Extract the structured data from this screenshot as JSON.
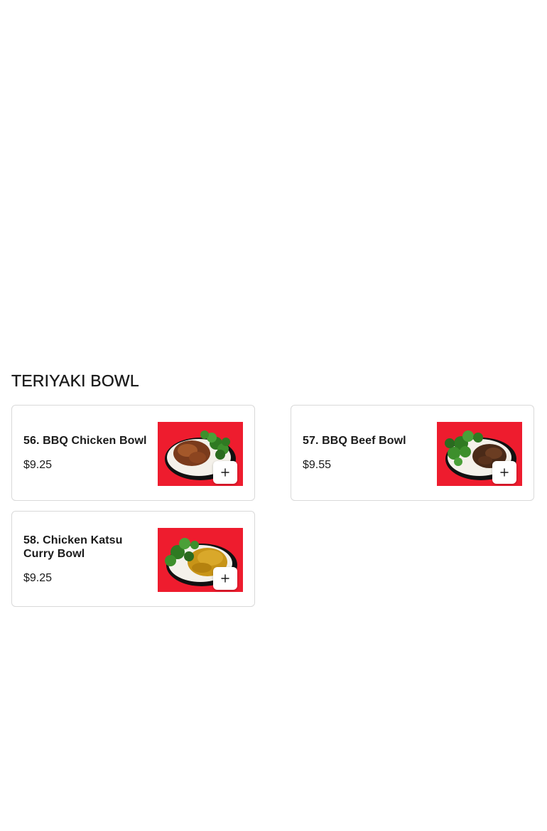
{
  "section": {
    "title": "TERIYAKI BOWL"
  },
  "items": [
    {
      "name": "56. BBQ Chicken Bowl",
      "price": "$9.25",
      "image_icon": "bbq-chicken-bowl-photo",
      "add_icon": "plus-icon"
    },
    {
      "name": "57. BBQ Beef Bowl",
      "price": "$9.55",
      "image_icon": "bbq-beef-bowl-photo",
      "add_icon": "plus-icon"
    },
    {
      "name": "58. Chicken Katsu Curry Bowl",
      "price": "$9.25",
      "image_icon": "chicken-katsu-curry-bowl-photo",
      "add_icon": "plus-icon"
    }
  ],
  "colors": {
    "photo_background": "#ee1c2e",
    "card_border": "#d9d9d9",
    "text": "#1a1a1a"
  }
}
